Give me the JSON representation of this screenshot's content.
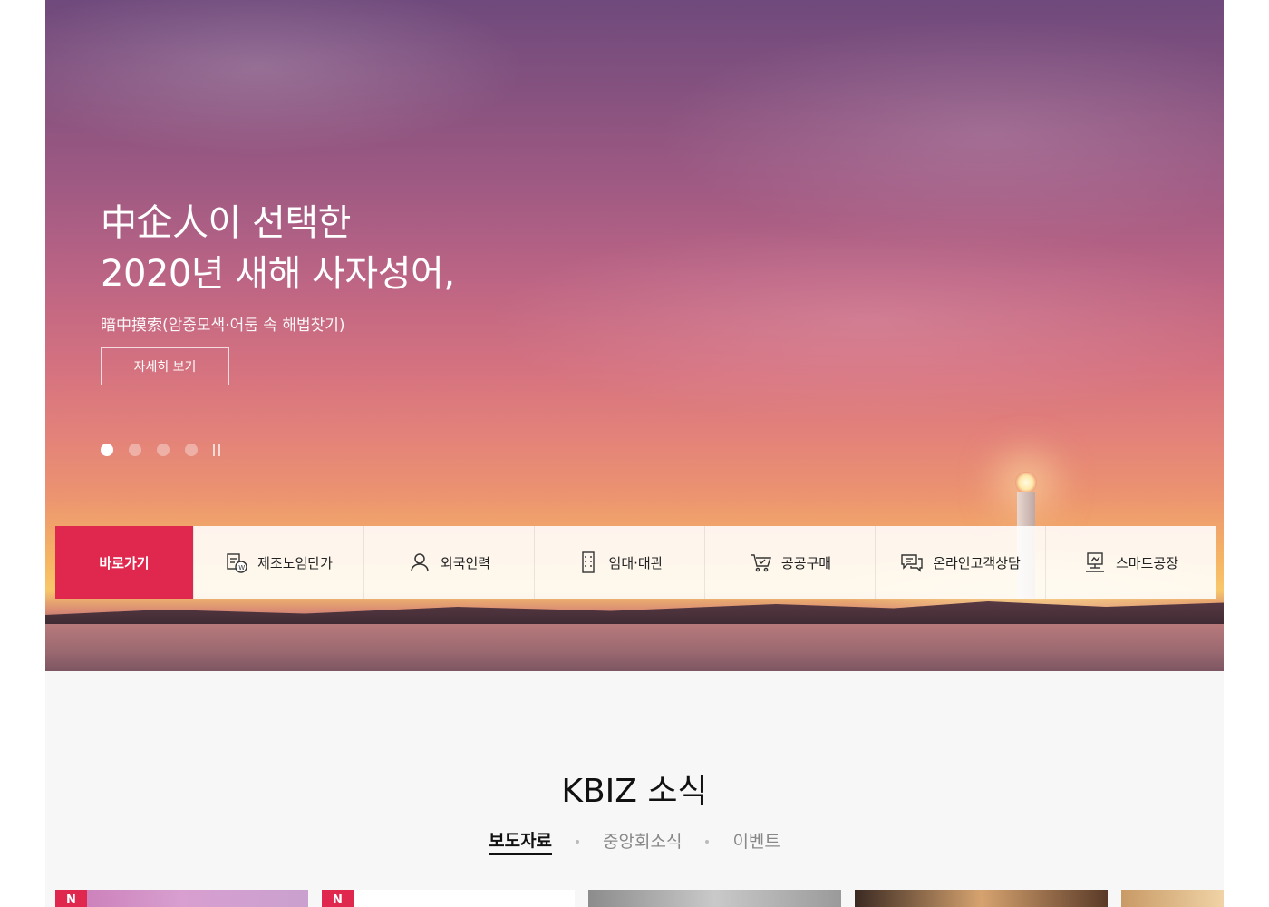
{
  "hero": {
    "headline_line1": "中企人이 선택한",
    "headline_line2": "2020년 새해 사자성어,",
    "subline": "暗中摸索(암중모색·어둠 속 해법찾기)",
    "detail_button": "자세히 보기",
    "slides_total": 4,
    "slide_active": 1
  },
  "quick_links": {
    "label": "바로가기",
    "items": [
      {
        "label": "제조노임단가",
        "icon": "wage-document-icon"
      },
      {
        "label": "외국인력",
        "icon": "person-icon"
      },
      {
        "label": "임대·대관",
        "icon": "building-icon"
      },
      {
        "label": "공공구매",
        "icon": "cart-icon"
      },
      {
        "label": "온라인고객상담",
        "icon": "chat-icon"
      },
      {
        "label": "스마트공장",
        "icon": "factory-icon"
      }
    ]
  },
  "news": {
    "title": "KBIZ 소식",
    "tabs": [
      "보도자료",
      "중앙회소식",
      "이벤트"
    ],
    "active_tab": "보도자료",
    "badge": "N"
  },
  "colors": {
    "accent": "#e0284f"
  }
}
